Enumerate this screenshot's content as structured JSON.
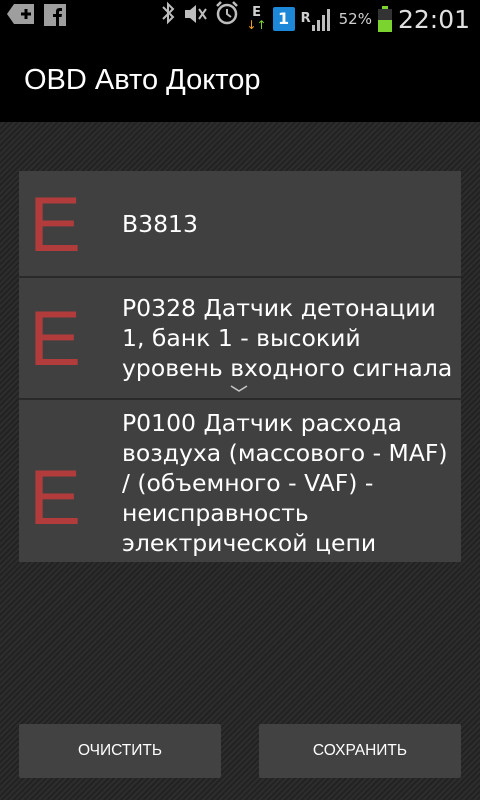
{
  "status_bar": {
    "icons": [
      "plus-icon",
      "facebook-icon",
      "bluetooth-icon",
      "mute-icon",
      "alarm-icon",
      "data-transfer-icon",
      "sim1-icon",
      "roaming-icon",
      "signal-icon",
      "battery-icon"
    ],
    "e_label": "E",
    "r_label": "R",
    "sim_number": "1",
    "battery_percent": "52%",
    "battery_level": 0.52,
    "time": "22:01"
  },
  "app": {
    "title": "OBD Авто Доктор"
  },
  "codes": [
    {
      "letter": "E",
      "text": "B3813"
    },
    {
      "letter": "E",
      "text": "P0328 Датчик детонации 1, банк 1 - высокий уровень входного сигнала"
    },
    {
      "letter": "E",
      "text": "P0100 Датчик расхода воздуха (массового - MAF) / (объемного - VAF) - неисправность электрической цепи"
    }
  ],
  "buttons": {
    "clear": "ОЧИСТИТЬ",
    "save": "СОХРАНИТЬ"
  },
  "colors": {
    "error_letter": "#b23b3b",
    "row_bg": "#404040",
    "battery": "#7bd32f",
    "sim_badge": "#1e88d8"
  }
}
